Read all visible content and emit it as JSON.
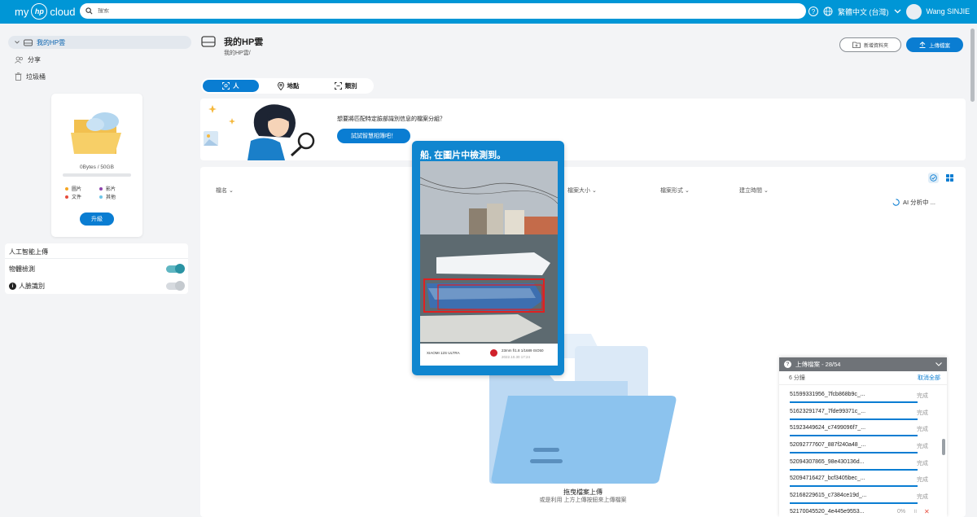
{
  "app": {
    "logo_prefix": "my",
    "logo_suffix": "cloud",
    "logo_mark": "hp"
  },
  "search": {
    "placeholder": "搜索"
  },
  "topbar": {
    "help_icon": "help-icon",
    "language": "繁體中文 (台灣)",
    "user_name": "Wang SINJIE"
  },
  "sidebar": {
    "items": [
      {
        "label": "我的HP雲",
        "icon": "drive-icon",
        "active": true
      },
      {
        "label": "分享",
        "icon": "users-icon"
      },
      {
        "label": "垃圾桶",
        "icon": "trash-icon"
      }
    ],
    "storage": {
      "usage_text": "0Bytes / 50GB",
      "used_fraction": 0,
      "legend": [
        {
          "label": "圖片",
          "color": "#f5a623"
        },
        {
          "label": "影片",
          "color": "#8e44ad"
        },
        {
          "label": "文件",
          "color": "#e74c3c"
        },
        {
          "label": "其他",
          "color": "#6ec6e8"
        }
      ],
      "upgrade_label": "升級"
    },
    "ai": {
      "title": "人工智能上傳",
      "object_detection": {
        "label": "物體檢測",
        "enabled": true
      },
      "face_recognition": {
        "label": "人臉識別",
        "enabled": false
      }
    }
  },
  "main": {
    "title": "我的HP雲",
    "breadcrumb": "我的HP雲/",
    "new_folder_label": "新增資料夾",
    "upload_label": "上傳檔案",
    "tabs": [
      {
        "label": "人",
        "icon": "face-scan-icon",
        "active": true
      },
      {
        "label": "地點",
        "icon": "location-pin-icon"
      },
      {
        "label": "類別",
        "icon": "category-icon"
      }
    ],
    "banner": {
      "question": "想要將匹配特定臉部識別信息的檔案分組？",
      "button": "試試智慧相簿吧！"
    },
    "columns": [
      "檔名",
      "檔案大小",
      "檔案形式",
      "建立時間"
    ],
    "drop_title": "拖曳檔案上傳",
    "drop_subtitle": "或是利用 上方上傳按鈕來上傳檔案",
    "ai_status": "AI 分析中 ..."
  },
  "popup": {
    "title": "船, 在圖片中檢測到。",
    "camera": "XIAOMI 12S ULTRA",
    "exif": "23mm f/1.8 1/1689 ISO50",
    "exif_sub": "2022.10.30  17:24"
  },
  "upload_panel": {
    "title": "上傳檔案 - 28/54",
    "count": "6 分鐘",
    "cancel_all": "取消全部",
    "files": [
      {
        "name": "51599331956_7fcb868b9c_...",
        "status": "完成"
      },
      {
        "name": "51623291747_7fde99371c_...",
        "status": "完成"
      },
      {
        "name": "51923449624_c7499096f7_...",
        "status": "完成"
      },
      {
        "name": "52092777607_887f240a48_...",
        "status": "完成"
      },
      {
        "name": "52094307865_98e430136d...",
        "status": "完成"
      },
      {
        "name": "52094716427_bcf3405bec_...",
        "status": "完成"
      },
      {
        "name": "52168229615_c7384ce19d_...",
        "status": "完成"
      },
      {
        "name": "52170045520_4e445e9553...",
        "status": "0%"
      }
    ]
  }
}
